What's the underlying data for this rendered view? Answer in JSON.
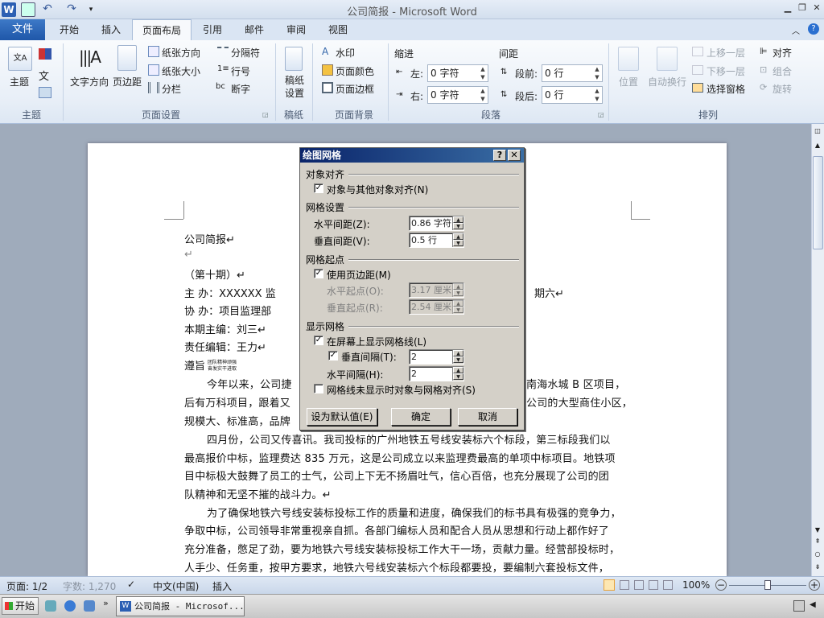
{
  "window": {
    "title": "公司简报 - Microsoft Word"
  },
  "tabs": {
    "file": "文件",
    "home": "开始",
    "insert": "插入",
    "layout": "页面布局",
    "references": "引用",
    "mailings": "邮件",
    "review": "审阅",
    "view": "视图"
  },
  "ribbon": {
    "theme": {
      "themes": "主题",
      "group": "主题"
    },
    "page_setup": {
      "text_direction": "文字方向",
      "margins": "页边距",
      "orientation": "纸张方向",
      "size": "纸张大小",
      "columns": "分栏",
      "breaks": "分隔符",
      "line_numbers": "行号",
      "hyphenation": "断字",
      "group": "页面设置"
    },
    "paper": {
      "paper_setup": "稿纸\n设置",
      "group": "稿纸"
    },
    "background": {
      "watermark": "水印",
      "page_color": "页面颜色",
      "page_borders": "页面边框",
      "group": "页面背景"
    },
    "paragraph": {
      "indent": "缩进",
      "left": "左:",
      "right": "右:",
      "left_value": "0 字符",
      "right_value": "0 字符",
      "spacing": "间距",
      "before": "段前:",
      "after": "段后:",
      "before_value": "0 行",
      "after_value": "0 行",
      "group": "段落"
    },
    "arrange": {
      "position": "位置",
      "wrap": "自动换行",
      "bring_forward": "上移一层",
      "send_backward": "下移一层",
      "selection_pane": "选择窗格",
      "align": "对齐",
      "group_btn": "组合",
      "rotate": "旋转",
      "group": "排列"
    }
  },
  "document": {
    "lines": [
      "公司简报↵",
      "↵",
      "（第十期）↵",
      "主    办：XXXXXX 监",
      "期六↵",
      "协    办：项目监理部",
      "本期主编：刘三↵",
      "责任编辑：王力↵",
      "遵旨",
      "团队精神顽强",
      "奋发实干进取"
    ],
    "para1": [
      "今年以来，公司捷",
      "南海水城 B 区项目，",
      "后有万科项目，跟着又",
      "公司的大型商住小区，",
      "规模大、标准高，品牌"
    ],
    "para2": [
      "四月份，公司又传喜讯。我司投标的广州地铁五号线安装标六个标段，第三标段我们以",
      "最高报价中标，监理费达 835 万元，这是公司成立以来监理费最高的单项中标项目。地铁项",
      "目中标极大鼓舞了员工的士气，公司上下无不扬眉吐气，信心百倍，也充分展现了公司的团",
      "队精神和无坚不摧的战斗力。↵"
    ],
    "para3": [
      "为了确保地铁六号线安装标投标工作的质量和进度，确保我们的标书具有极强的竞争力，",
      "争取中标，公司领导非常重视亲自抓。各部门编标人员和配合人员从思想和行动上都作好了",
      "充分准备，憋足了劲，要为地铁六号线安装标投标工作大干一场，贡献力量。经营部投标时，",
      "人手少、任务重，按甲方要求，地铁六号线安装标六个标段都要投，要编制六套投标文件，"
    ]
  },
  "dialog": {
    "title": "绘图网格",
    "help": "?",
    "close": "✕",
    "object_snap": {
      "section": "对象对齐",
      "snap_to_objects": "对象与其他对象对齐(N)",
      "snap_to_objects_checked": true
    },
    "grid_settings": {
      "section": "网格设置",
      "h_spacing_label": "水平间距(Z):",
      "h_spacing_value": "0.86 字符",
      "v_spacing_label": "垂直间距(V):",
      "v_spacing_value": "0.5 行"
    },
    "grid_origin": {
      "section": "网格起点",
      "use_margins": "使用页边距(M)",
      "use_margins_checked": true,
      "h_origin_label": "水平起点(O):",
      "h_origin_value": "3.17 厘米",
      "v_origin_label": "垂直起点(R):",
      "v_origin_value": "2.54 厘米"
    },
    "show_grid": {
      "section": "显示网格",
      "show_lines": "在屏幕上显示网格线(L)",
      "show_lines_checked": true,
      "vertical_every": "垂直间隔(T):",
      "vertical_every_checked": true,
      "vertical_every_value": "2",
      "horizontal_every": "水平间隔(H):",
      "horizontal_every_value": "2",
      "snap_when_hidden": "网格线未显示时对象与网格对齐(S)",
      "snap_when_hidden_checked": false
    },
    "buttons": {
      "default": "设为默认值(E)",
      "ok": "确定",
      "cancel": "取消"
    }
  },
  "statusbar": {
    "page": "页面: 1/2",
    "words": "字数: 1,270",
    "language": "中文(中国)",
    "mode": "插入",
    "zoom": "100%",
    "minus": "−",
    "plus": "+",
    "zoom_level_percent": 100
  },
  "taskbar": {
    "start": "开始",
    "task": "公司简报 - Microsof..."
  }
}
